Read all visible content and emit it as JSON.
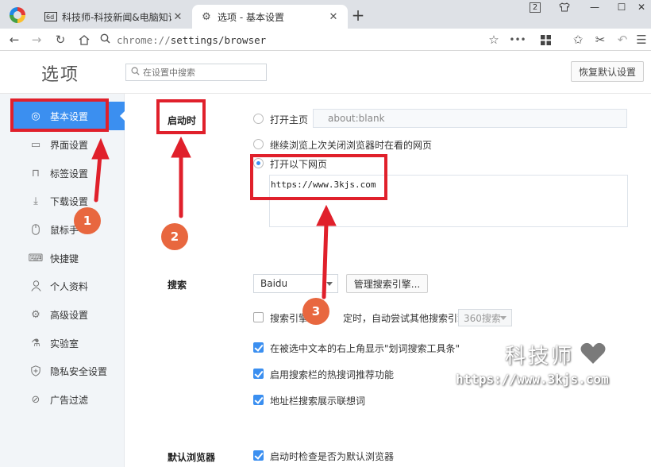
{
  "tabs": [
    {
      "title": "科技师-科技新闻&电脑知识",
      "icon": "tech-site-icon"
    },
    {
      "title": "选项 - 基本设置",
      "icon": "gear-icon"
    }
  ],
  "window_controls": {
    "badge": "2"
  },
  "address_bar": {
    "scheme": "chrome://",
    "path": "settings/browser"
  },
  "header": {
    "title": "选项",
    "search_placeholder": "在设置中搜索",
    "restore_button": "恢复默认设置"
  },
  "sidebar": {
    "items": [
      {
        "label": "基本设置",
        "icon": "settings-circle-icon",
        "active": true
      },
      {
        "label": "界面设置",
        "icon": "window-icon"
      },
      {
        "label": "标签设置",
        "icon": "tab-icon"
      },
      {
        "label": "下载设置",
        "icon": "download-icon"
      },
      {
        "label": "鼠标手",
        "icon": "mouse-icon"
      },
      {
        "label": "快捷键",
        "icon": "keyboard-icon"
      },
      {
        "label": "个人资料",
        "icon": "user-icon"
      },
      {
        "label": "高级设置",
        "icon": "advanced-gear-icon"
      },
      {
        "label": "实验室",
        "icon": "lab-flask-icon"
      },
      {
        "label": "隐私安全设置",
        "icon": "shield-icon"
      },
      {
        "label": "广告过滤",
        "icon": "block-icon"
      }
    ]
  },
  "startup": {
    "label": "启动时",
    "options": [
      {
        "label": "打开主页",
        "selected": false
      },
      {
        "label": "继续浏览上次关闭浏览器时在看的网页",
        "selected": false
      },
      {
        "label": "打开以下网页",
        "selected": true
      }
    ],
    "home_page_value": "about:blank",
    "pages": [
      "https://www.3kjs.com"
    ]
  },
  "search": {
    "label": "搜索",
    "engine": "Baidu",
    "manage_button": "管理搜索引擎...",
    "fallback_option": {
      "label_a": "搜索引擎",
      "label_b": "定时，自动尝试其他搜索引擎：",
      "checked": false,
      "engine": "360搜索"
    },
    "checkboxes": [
      {
        "label": "在被选中文本的右上角显示\"划词搜索工具条\"",
        "checked": true
      },
      {
        "label": "启用搜索栏的热搜词推荐功能",
        "checked": true
      },
      {
        "label": "地址栏搜索展示联想词",
        "checked": true
      }
    ]
  },
  "default_browser": {
    "label": "默认浏览器",
    "checkbox": {
      "label": "启动时检查是否为默认浏览器",
      "checked": true
    }
  },
  "annotations": {
    "markers": [
      "1",
      "2",
      "3"
    ],
    "accent_color": "#e0202b",
    "marker_color": "#e8673f"
  },
  "watermark": {
    "text": "科技师",
    "url": "https://www.3kjs.com"
  },
  "colors": {
    "active_nav": "#3b8ff0",
    "sidebar_bg": "#f2f5f8",
    "tabstrip_bg": "#dee1e6"
  }
}
